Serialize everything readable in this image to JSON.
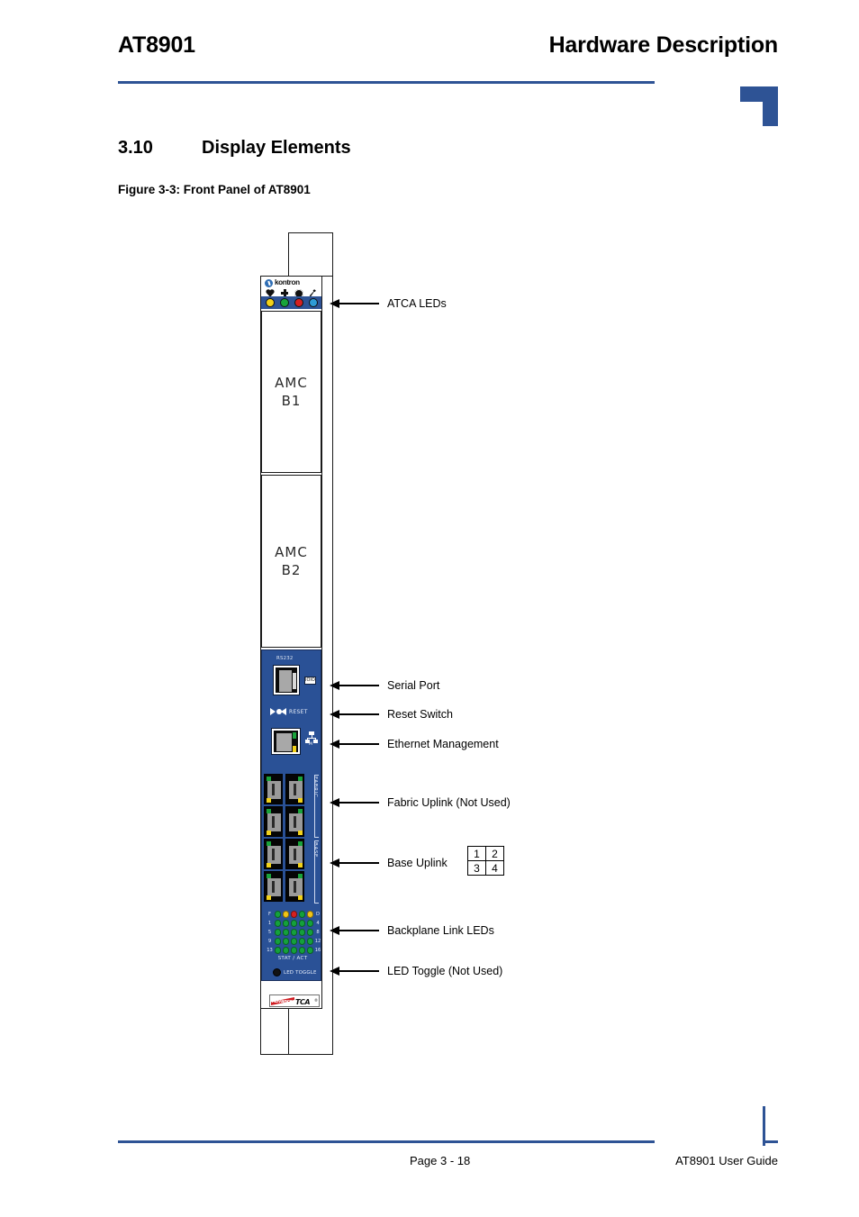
{
  "header": {
    "doc_title": "AT8901",
    "section_title": "Hardware Description"
  },
  "section": {
    "number": "3.10",
    "title": "Display Elements"
  },
  "figure": {
    "caption": "Figure 3-3:  Front Panel of AT8901"
  },
  "panel": {
    "brand": "kontron",
    "atca_leds": {
      "symbols": [
        "heart-icon",
        "cross-icon",
        "target-icon",
        "wrench-icon"
      ],
      "colors": [
        "#f2d21a",
        "#19a33a",
        "#d62020",
        "#2e9bd6"
      ]
    },
    "amc_bays": [
      {
        "line1": "AMC",
        "line2": "B1"
      },
      {
        "line1": "AMC",
        "line2": "B2"
      }
    ],
    "serial": {
      "label": "RS232",
      "side_icon_text": "IOIOI"
    },
    "reset": {
      "label": "RESET"
    },
    "ethernet": {
      "icon_label": "M"
    },
    "uplink": {
      "fabric_legend": "FABRIC",
      "base_legend": "BASE",
      "jack_count": 8
    },
    "backplane_leds": {
      "top_left_label": "F",
      "top_right_label": "D",
      "row_left_labels": [
        "1",
        "5",
        "9",
        "13"
      ],
      "row_right_labels": [
        "4",
        "8",
        "12",
        "16"
      ],
      "top_row_colors": [
        "green",
        "amber",
        "red",
        "green",
        "amber"
      ],
      "stat_act": "STAT / ACT"
    },
    "led_toggle": {
      "label": "LED TOGGLE"
    },
    "logo": {
      "word_advanced": "Advanced",
      "word_tca": "TCA",
      "registered": "®"
    }
  },
  "callouts": [
    {
      "label": "ATCA LEDs"
    },
    {
      "label": "Serial Port"
    },
    {
      "label": "Reset Switch"
    },
    {
      "label": "Ethernet Management"
    },
    {
      "label": "Fabric Uplink (Not Used)"
    },
    {
      "label": "Base Uplink"
    },
    {
      "label": "Backplane Link LEDs"
    },
    {
      "label": "LED Toggle (Not Used)"
    }
  ],
  "port_table": {
    "rows": [
      [
        "1",
        "2"
      ],
      [
        "3",
        "4"
      ]
    ]
  },
  "footer": {
    "page": "Page 3 - 18",
    "guide": "AT8901 User Guide"
  },
  "colors": {
    "accent_blue": "#2e5395",
    "panel_blue": "#2a5196"
  }
}
